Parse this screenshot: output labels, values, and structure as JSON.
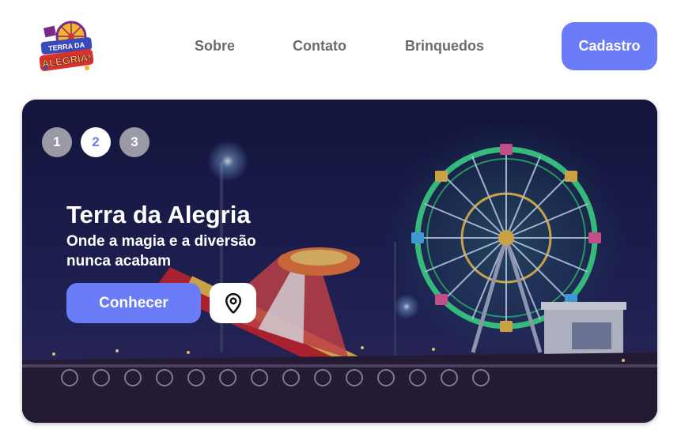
{
  "brand": {
    "logo_text_top": "TERRA DA",
    "logo_text_main": "ALEGRIA!",
    "logo_icon": "ferris-wheel-logo"
  },
  "nav": {
    "items": [
      {
        "label": "Sobre"
      },
      {
        "label": "Contato"
      },
      {
        "label": "Brinquedos"
      }
    ],
    "cta_label": "Cadastro"
  },
  "hero": {
    "title": "Terra da Alegria",
    "subtitle": "Onde a magia e a diversão nunca acabam",
    "primary_label": "Conhecer",
    "location_icon": "map-pin-icon",
    "background": "night-amusement-park-photo",
    "slides": [
      {
        "label": "1",
        "active": false
      },
      {
        "label": "2",
        "active": true
      },
      {
        "label": "3",
        "active": false
      }
    ]
  },
  "colors": {
    "accent": "#6a7cf8",
    "nav_text": "#6b6b6b",
    "hero_bg": "#1b1d4a",
    "pager_inactive": "#9a9aa6"
  }
}
